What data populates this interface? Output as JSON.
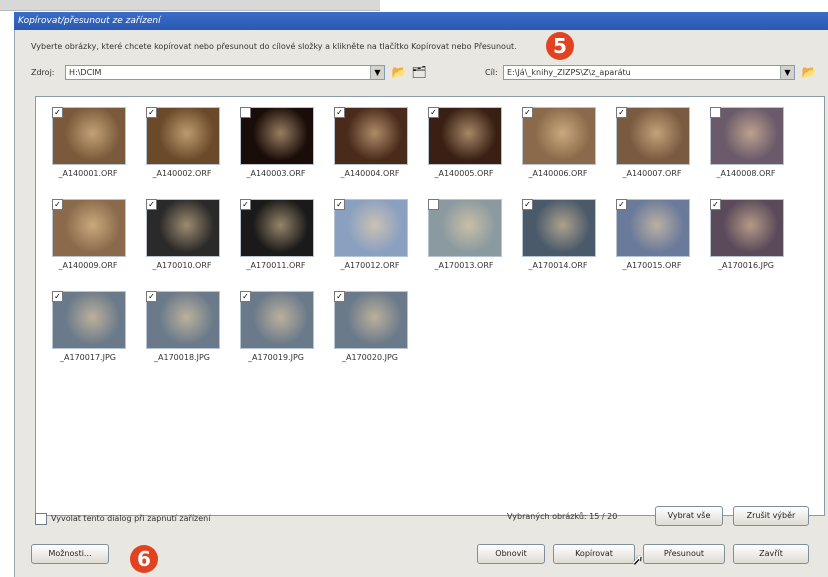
{
  "window": {
    "title": "Kopírovat/přesunout ze zařízení"
  },
  "instruction": "Vyberte obrázky, které chcete kopírovat nebo přesunout do cílové složky a klikněte na tlačítko Kopírovat nebo Přesunout.",
  "source": {
    "label": "Zdroj:",
    "value": "H:\\DCIM"
  },
  "target": {
    "label": "Cíl:",
    "value": "E:\\Já\\_knihy_ZIZPS\\Z\\z_aparátu"
  },
  "thumbnails": [
    {
      "caption": "_A140001.ORF",
      "checked": true,
      "color": "#7a5a3a"
    },
    {
      "caption": "_A140002.ORF",
      "checked": true,
      "color": "#6b4a2a"
    },
    {
      "caption": "_A140003.ORF",
      "checked": false,
      "color": "#1a0c08"
    },
    {
      "caption": "_A140004.ORF",
      "checked": true,
      "color": "#4a2a1a"
    },
    {
      "caption": "_A140005.ORF",
      "checked": true,
      "color": "#3a2014"
    },
    {
      "caption": "_A140006.ORF",
      "checked": true,
      "color": "#8a6a4a"
    },
    {
      "caption": "_A140007.ORF",
      "checked": true,
      "color": "#7a5a40"
    },
    {
      "caption": "_A140008.ORF",
      "checked": false,
      "color": "#6a5a6a"
    },
    {
      "caption": "_A140009.ORF",
      "checked": true,
      "color": "#8a6a4a"
    },
    {
      "caption": "_A170010.ORF",
      "checked": true,
      "color": "#2a2a2a"
    },
    {
      "caption": "_A170011.ORF",
      "checked": true,
      "color": "#1a1a1a"
    },
    {
      "caption": "_A170012.ORF",
      "checked": true,
      "color": "#8aa0c0"
    },
    {
      "caption": "_A170013.ORF",
      "checked": false,
      "color": "#8a9aa0"
    },
    {
      "caption": "_A170014.ORF",
      "checked": true,
      "color": "#4a5a6a"
    },
    {
      "caption": "_A170015.ORF",
      "checked": true,
      "color": "#6a7a9a"
    },
    {
      "caption": "_A170016.JPG",
      "checked": true,
      "color": "#5a4a5a"
    },
    {
      "caption": "_A170017.JPG",
      "checked": true,
      "color": "#6a7a8a"
    },
    {
      "caption": "_A170018.JPG",
      "checked": true,
      "color": "#6a7a8a"
    },
    {
      "caption": "_A170019.JPG",
      "checked": true,
      "color": "#6a7a8a"
    },
    {
      "caption": "_A170020.JPG",
      "checked": true,
      "color": "#6a7a8a"
    }
  ],
  "footer": {
    "autostart_label": "Vyvolat tento dialog při zapnutí zařízení",
    "selected_text": "Vybraných obrázků: 15 / 20",
    "select_all": "Vybrat vše",
    "clear_selection": "Zrušit výběr",
    "options": "Možnosti...",
    "refresh": "Obnovit",
    "copy": "Kopírovat",
    "move": "Přesunout",
    "close": "Zavřít"
  },
  "markers": {
    "m5": "5",
    "m6": "6"
  },
  "colors": {
    "marker": "#e2421f",
    "title": "#2a58b0"
  }
}
